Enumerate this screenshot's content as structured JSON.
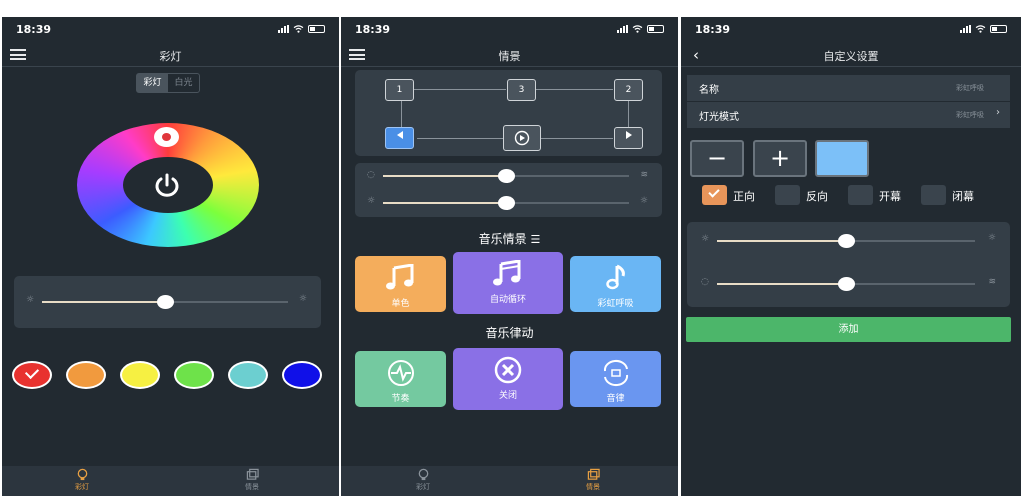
{
  "status": {
    "time": "18:39"
  },
  "screen1": {
    "title": "彩灯",
    "segment": [
      "彩灯",
      "白光"
    ],
    "brightness": 0.5,
    "swatches": [
      "#e8322f",
      "#f19a3e",
      "#f6f042",
      "#6ee24a",
      "#6ccfd0",
      "#1010e8"
    ],
    "tabs": [
      "彩灯",
      "情景"
    ]
  },
  "screen2": {
    "title": "情景",
    "nodes": [
      "1",
      "3",
      "2"
    ],
    "slider_top": 0.5,
    "slider_bottom": 0.5,
    "music_scene_title": "音乐情景",
    "music_scene_cards": [
      "单色",
      "自动循环",
      "彩虹呼吸"
    ],
    "music_rhythm_title": "音乐律动",
    "music_rhythm_cards": [
      "节奏",
      "关闭",
      "音律"
    ],
    "tabs": [
      "彩灯",
      "情景"
    ]
  },
  "screen3": {
    "title": "自定义设置",
    "name_label": "名称",
    "name_value": "彩虹呼吸",
    "mode_label": "灯光模式",
    "mode_value": "彩虹呼吸",
    "minus": "−",
    "plus": "+",
    "selected_color": "#7cc0f8",
    "options": [
      "正向",
      "反向",
      "开幕",
      "闭幕"
    ],
    "slider_top": 0.5,
    "slider_bottom": 0.5,
    "add_label": "添加"
  }
}
